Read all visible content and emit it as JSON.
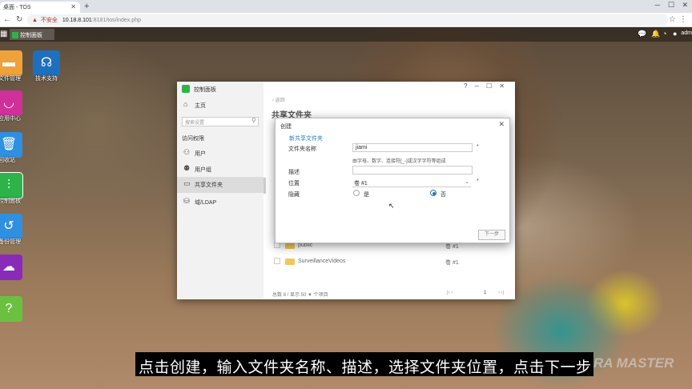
{
  "browser": {
    "tab_title": "桌面 - TOS",
    "tab_close_icon": "close-icon",
    "insecure_label": "不安全",
    "url_host": "10.18.8.101",
    "url_rest": ":8181/tos/index.php"
  },
  "taskbar": {
    "app_label": "控制面板",
    "user": "adm"
  },
  "desktop_icons": [
    {
      "label": "文件管理",
      "color": "#f0a23a"
    },
    {
      "label": "技术支持",
      "color": "#1f6fbf"
    },
    {
      "label": "应用中心",
      "color": "#d0309a"
    },
    {
      "label": "回收站",
      "color": "#2f8fe0"
    },
    {
      "label": "控制面板",
      "color": "#2db34a"
    },
    {
      "label": "备份管理",
      "color": "#2f8fe0"
    },
    {
      "label": "",
      "color": "#8a2ab8"
    },
    {
      "label": "",
      "color": "#6cc040"
    }
  ],
  "control_panel": {
    "title": "控制面板",
    "home": "主页",
    "search_placeholder": "搜索设置",
    "section_access": "访问权限",
    "items": [
      "用户",
      "用户组",
      "共享文件夹",
      "域/LDAP"
    ],
    "back": "返回",
    "page_title": "共享文件夹",
    "rows": [
      {
        "name": "public",
        "volume": "卷 #1"
      },
      {
        "name": "SurveillanceVideos",
        "volume": "卷 #1"
      }
    ],
    "footer": "总数 8 / 显示 50 ▼ 个项目",
    "page_current": "1"
  },
  "dialog": {
    "title": "创建",
    "subtitle": "新共享文件夹",
    "name_label": "文件夹名称",
    "name_value": "jiami",
    "name_hint": "由字母、数字、连接符[_-]或汉字字符等组成",
    "desc_label": "描述",
    "desc_value": "",
    "location_label": "位置",
    "location_value": "卷 #1",
    "hidden_label": "隐藏",
    "yes": "是",
    "no": "否",
    "hidden_selected": "否",
    "next": "下一步",
    "required_mark": "*"
  },
  "subtitle": "点击创建，输入文件夹名称、描述，选择文件夹位置，点击下一步",
  "watermark": "RA MASTER"
}
